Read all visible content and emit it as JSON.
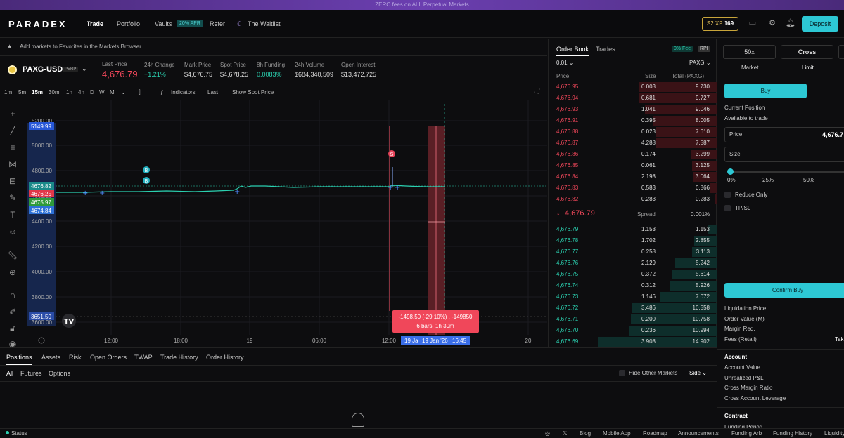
{
  "banner": "ZERO fees on ALL Perpetual Markets",
  "nav": {
    "logo": "PARADEX",
    "items": [
      "Trade",
      "Portfolio",
      "Vaults",
      "Refer",
      "The Waitlist"
    ],
    "vaults_badge": "20% APR",
    "xp_label": "S2 XP",
    "xp_value": "169",
    "deposit": "Deposit"
  },
  "favorites_text": "Add markets to Favorites in the Markets Browser",
  "market": {
    "symbol": "PAXG-USD",
    "perp_badge": "PERP",
    "stats": [
      {
        "label": "Last Price",
        "value": "4,676.79"
      },
      {
        "label": "24h Change",
        "value": "+1.21%"
      },
      {
        "label": "Mark Price",
        "value": "$4,676.75"
      },
      {
        "label": "Spot Price",
        "value": "$4,678.25"
      },
      {
        "label": "8h Funding",
        "value": "0.0083%"
      },
      {
        "label": "24h Volume",
        "value": "$684,340,509"
      },
      {
        "label": "Open Interest",
        "value": "$13,472,725"
      }
    ]
  },
  "timeframes": [
    "1m",
    "5m",
    "15m",
    "1h",
    "4h",
    "D",
    "W",
    "M"
  ],
  "chart_toolbar": {
    "indicators": "Indicators",
    "last": "Last",
    "show_spot": "Show Spot Price"
  },
  "chart": {
    "y_ticks": [
      "5200.00",
      "5000.00",
      "4800.00",
      "4600.00",
      "4400.00",
      "4200.00",
      "4000.00",
      "3800.00",
      "3600.00"
    ],
    "x_ticks": [
      "12:00",
      "18:00",
      "19",
      "06:00",
      "12:00",
      "20"
    ],
    "price_tags": [
      "5149.99",
      "4676.82",
      "4676.25",
      "4675.97",
      "4674.84",
      "3651.50"
    ],
    "measure_line1": "-1498.50 (-29.10%) , -149850",
    "measure_line2": "6 bars, 1h 30m",
    "cursor_x1": "19 Ja",
    "cursor_x2": "19 Jan '26",
    "cursor_x3": "16:45",
    "marker_s": "S",
    "marker_b": "B"
  },
  "orderbook": {
    "tabs": [
      "Order Book",
      "Trades"
    ],
    "fee_badge": "0% Fee",
    "rpi_badge": "RPI",
    "tick": "0.01",
    "unit": "PAXG",
    "headers": [
      "Price",
      "Size",
      "Total (PAXG)"
    ],
    "asks": [
      [
        "4,676.95",
        "0.003",
        "9.730"
      ],
      [
        "4,676.94",
        "0.681",
        "9.727"
      ],
      [
        "4,676.93",
        "1.041",
        "9.046"
      ],
      [
        "4,676.91",
        "0.395",
        "8.005"
      ],
      [
        "4,676.88",
        "0.023",
        "7.610"
      ],
      [
        "4,676.87",
        "4.288",
        "7.587"
      ],
      [
        "4,676.86",
        "0.174",
        "3.299"
      ],
      [
        "4,676.85",
        "0.061",
        "3.125"
      ],
      [
        "4,676.84",
        "2.198",
        "3.064"
      ],
      [
        "4,676.83",
        "0.583",
        "0.866"
      ],
      [
        "4,676.82",
        "0.283",
        "0.283"
      ]
    ],
    "ask_depth": [
      0.653,
      0.652,
      0.606,
      0.537,
      0.51,
      0.509,
      0.221,
      0.21,
      0.205,
      0.058,
      0.019
    ],
    "spread_price": "4,676.79",
    "spread_label": "Spread",
    "spread_value": "0.001%",
    "bids": [
      [
        "4,676.79",
        "1.153",
        "1.153"
      ],
      [
        "4,676.78",
        "1.702",
        "2.855"
      ],
      [
        "4,676.77",
        "0.258",
        "3.113"
      ],
      [
        "4,676.76",
        "2.129",
        "5.242"
      ],
      [
        "4,676.75",
        "0.372",
        "5.614"
      ],
      [
        "4,676.74",
        "0.312",
        "5.926"
      ],
      [
        "4,676.73",
        "1.146",
        "7.072"
      ],
      [
        "4,676.72",
        "3.486",
        "10.558"
      ],
      [
        "4,676.71",
        "0.200",
        "10.758"
      ],
      [
        "4,676.70",
        "0.236",
        "10.994"
      ],
      [
        "4,676.69",
        "3.908",
        "14.902"
      ]
    ],
    "bid_depth": [
      0.077,
      0.192,
      0.209,
      0.352,
      0.377,
      0.398,
      0.475,
      0.709,
      0.722,
      0.738,
      1.0
    ]
  },
  "order_panel": {
    "leverage": "50x",
    "margin": "Cross",
    "types": [
      "Market",
      "Limit"
    ],
    "buy": "Buy",
    "current_position": "Current Position",
    "available": "Available to trade",
    "price_label": "Price",
    "price_value": "4,676.7",
    "size_label": "Size",
    "slider_marks": [
      "0%",
      "25%",
      "50%"
    ],
    "reduce_only": "Reduce Only",
    "tpsl": "TP/SL",
    "confirm": "Confirm Buy",
    "info": [
      "Liquidation Price",
      "Order Value (M)",
      "Margin Req.",
      "Fees (Retail)"
    ],
    "fees_value": "Tak",
    "account_title": "Account",
    "account": [
      "Account Value",
      "Unrealized P&L",
      "Cross Margin Ratio",
      "Cross Account Leverage"
    ],
    "contract_title": "Contract",
    "contract_first": "Funding Period"
  },
  "positions": {
    "tabs": [
      "Positions",
      "Assets",
      "Risk",
      "Open Orders",
      "TWAP",
      "Trade History",
      "Order History"
    ],
    "subtabs": [
      "All",
      "Futures",
      "Options"
    ],
    "hide_other": "Hide Other Markets",
    "side": "Side"
  },
  "footer": {
    "status": "Status",
    "links": [
      "Blog",
      "Mobile App",
      "Roadmap",
      "Announcements",
      "Funding Arb",
      "Funding History",
      "Liquidity"
    ]
  },
  "colors": {
    "accent": "#2dc8d4",
    "ask": "#f0475a",
    "bid": "#2bd0b0"
  }
}
